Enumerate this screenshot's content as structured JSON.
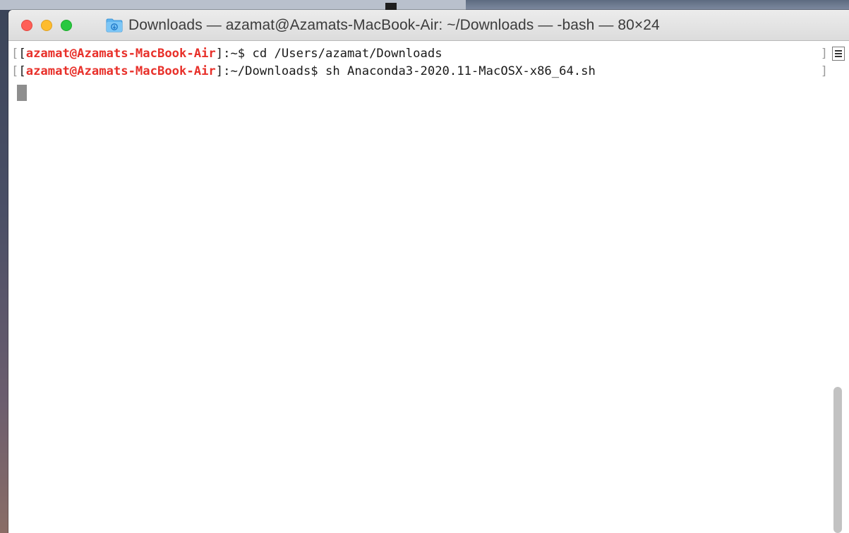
{
  "window": {
    "title": "Downloads — azamat@Azamats-MacBook-Air: ~/Downloads — -bash — 80×24",
    "folder_icon": "folder-icon"
  },
  "terminal": {
    "lines": [
      {
        "open_mark": "[",
        "bracket_open": "[",
        "user": "azamat@Azamats-MacBook-Air",
        "rest": "]:~$ cd /Users/azamat/Downloads",
        "close_mark": "]"
      },
      {
        "open_mark": "[",
        "bracket_open": "[",
        "user": "azamat@Azamats-MacBook-Air",
        "rest": "]:~/Downloads$ sh Anaconda3-2020.11-MacOSX-x86_64.sh",
        "close_mark": "]"
      }
    ],
    "prompt_color": "#e8302a"
  },
  "icons": {
    "scroll_toggle": "list-icon"
  }
}
